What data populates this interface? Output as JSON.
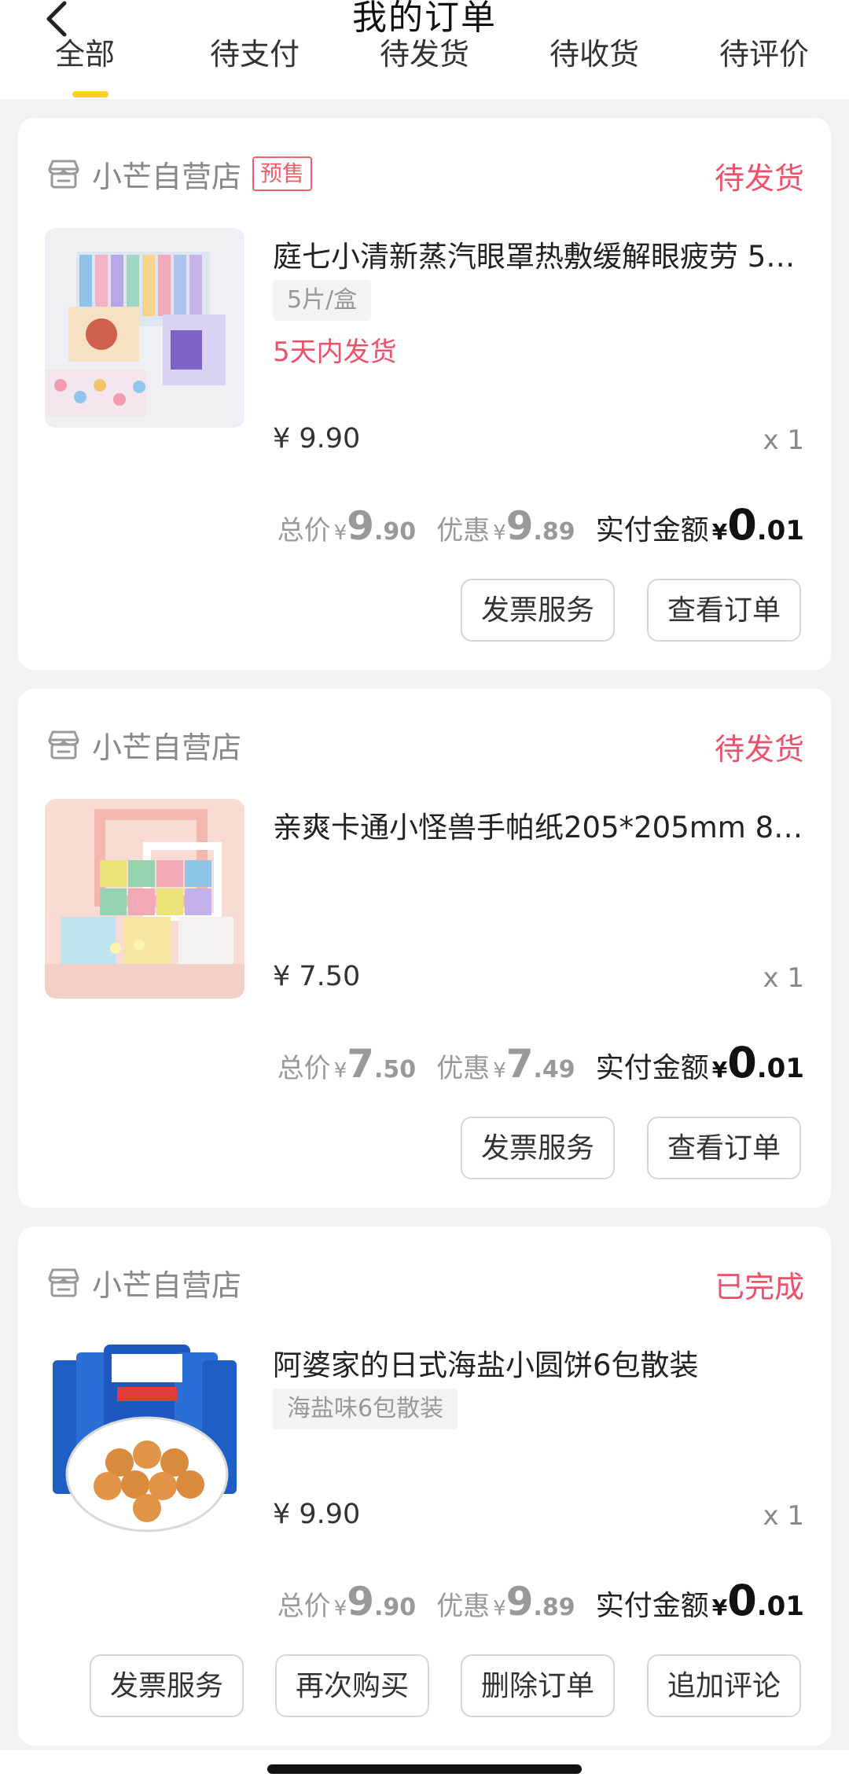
{
  "header": {
    "title": "我的订单",
    "tabs": [
      "全部",
      "待支付",
      "待发货",
      "待收货",
      "待评价"
    ]
  },
  "orders": [
    {
      "shop": "小芒自营店",
      "badge": "预售",
      "status": "待发货",
      "title": "庭七小清新蒸汽眼罩热敷缓解眼疲劳 5…",
      "spec": "5片/盒",
      "ship_note": "5天内发货",
      "unit_price": "¥ 9.90",
      "qty": "x 1",
      "total_label": "总价",
      "total_int": "9",
      "total_dec": ".90",
      "discount_label": "优惠",
      "discount_int": "9",
      "discount_dec": ".89",
      "pay_label": "实付金额",
      "pay_int": "0",
      "pay_dec": ".01",
      "buttons": [
        "发票服务",
        "查看订单"
      ]
    },
    {
      "shop": "小芒自营店",
      "status": "待发货",
      "title": "亲爽卡通小怪兽手帕纸205*205mm 8…",
      "unit_price": "¥ 7.50",
      "qty": "x 1",
      "total_label": "总价",
      "total_int": "7",
      "total_dec": ".50",
      "discount_label": "优惠",
      "discount_int": "7",
      "discount_dec": ".49",
      "pay_label": "实付金额",
      "pay_int": "0",
      "pay_dec": ".01",
      "buttons": [
        "发票服务",
        "查看订单"
      ]
    },
    {
      "shop": "小芒自营店",
      "status": "已完成",
      "title": "阿婆家的日式海盐小圆饼6包散装",
      "spec": "海盐味6包散装",
      "unit_price": "¥ 9.90",
      "qty": "x 1",
      "total_label": "总价",
      "total_int": "9",
      "total_dec": ".90",
      "discount_label": "优惠",
      "discount_int": "9",
      "discount_dec": ".89",
      "pay_label": "实付金额",
      "pay_int": "0",
      "pay_dec": ".01",
      "buttons": [
        "发票服务",
        "再次购买",
        "删除订单",
        "追加评论"
      ]
    }
  ],
  "currency_symbol": "¥",
  "colors": {
    "accent_yellow": "#ffcf26",
    "status_red": "#f0506a"
  }
}
